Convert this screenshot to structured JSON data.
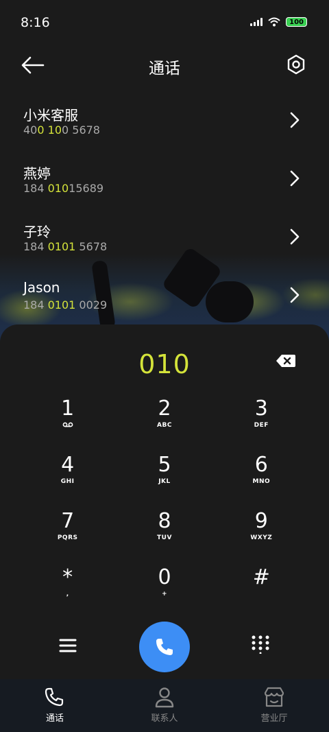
{
  "status_bar": {
    "time": "8:16",
    "battery": "100"
  },
  "header": {
    "title": "通话"
  },
  "results": [
    {
      "name": "小米客服",
      "number_parts": [
        "40",
        "0",
        " ",
        "10",
        "0 5678"
      ]
    },
    {
      "name": "燕婷",
      "number_parts": [
        "184 ",
        "010",
        "15689"
      ]
    },
    {
      "name": "子玲",
      "number_parts": [
        "184 ",
        "0101",
        " 5678"
      ]
    },
    {
      "name": "Jason",
      "number_parts": [
        "184 ",
        "0101",
        " 0029"
      ]
    }
  ],
  "dialer": {
    "input": "010",
    "keys": [
      {
        "digit": "1",
        "sub": ""
      },
      {
        "digit": "2",
        "sub": "ABC"
      },
      {
        "digit": "3",
        "sub": "DEF"
      },
      {
        "digit": "4",
        "sub": "GHI"
      },
      {
        "digit": "5",
        "sub": "JKL"
      },
      {
        "digit": "6",
        "sub": "MNO"
      },
      {
        "digit": "7",
        "sub": "PQRS"
      },
      {
        "digit": "8",
        "sub": "TUV"
      },
      {
        "digit": "9",
        "sub": "WXYZ"
      },
      {
        "digit": "*",
        "sub": ","
      },
      {
        "digit": "0",
        "sub": "+"
      },
      {
        "digit": "#",
        "sub": ""
      }
    ]
  },
  "bottom_nav": {
    "calls": "通话",
    "contacts": "联系人",
    "store": "营业厅"
  },
  "colors": {
    "accent": "#d4e33a",
    "call_button": "#3d8ef5",
    "battery": "#3ad153"
  }
}
